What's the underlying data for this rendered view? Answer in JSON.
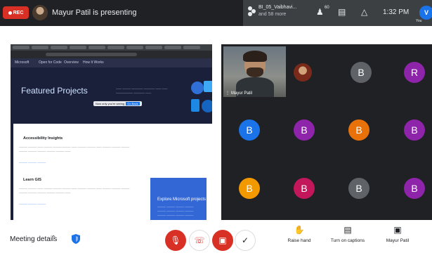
{
  "top_bar": {
    "rec_label": "REC",
    "presenting": "Mayur Patil is presenting",
    "presentation_title": "BI_05_Vaibhavi...",
    "presentation_subtitle": "and 58 more",
    "participant_count": "60",
    "clock": "1:32 PM",
    "user_initial": "V",
    "you_label": "You"
  },
  "presentation": {
    "hero_title": "Featured Projects",
    "hover_tip": "Now only you're seeing",
    "hover_tip_btn": "Go Back",
    "nav_items": [
      "Microsoft",
      "Open for Code",
      "Overview",
      "How It Works"
    ],
    "items": [
      {
        "heading": "Accessibility Insights"
      },
      {
        "heading": "Learn GIS"
      }
    ],
    "callout_title": "Explore Microsoft projects"
  },
  "participants": {
    "presenter_name": "Mayur Patil",
    "avatars": [
      {
        "letter": "B",
        "color": "#5f6368"
      },
      {
        "letter": "R",
        "color": "#8e24aa"
      },
      {
        "letter": "B",
        "color": "#1a73e8"
      },
      {
        "letter": "B",
        "color": "#8e24aa"
      },
      {
        "letter": "B",
        "color": "#e8710a"
      },
      {
        "letter": "B",
        "color": "#8e24aa"
      },
      {
        "letter": "B",
        "color": "#f29900"
      },
      {
        "letter": "B",
        "color": "#c2185b"
      },
      {
        "letter": "B",
        "color": "#5f6368"
      },
      {
        "letter": "B",
        "color": "#8e24aa"
      }
    ]
  },
  "bottom_bar": {
    "meeting_details": "Meeting details",
    "raise_hand": "Raise hand",
    "captions": "Turn on captions",
    "presenter": "Mayur Patil"
  }
}
